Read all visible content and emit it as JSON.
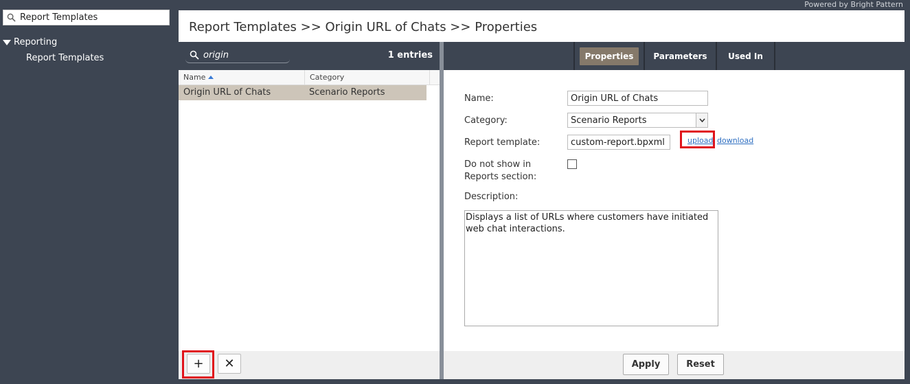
{
  "sidebar": {
    "search_value": "Report Templates",
    "tree": [
      {
        "label": "Reporting",
        "children": [
          {
            "label": "Report Templates"
          }
        ]
      }
    ]
  },
  "powered_by": "Powered by Bright Pattern",
  "breadcrumb": "Report Templates >> Origin URL of Chats >> Properties",
  "list": {
    "search_value": "origin",
    "entries_count": "1 entries",
    "columns": [
      "Name",
      "Category"
    ],
    "rows": [
      {
        "name": "Origin URL of Chats",
        "category": "Scenario Reports",
        "selected": true
      }
    ],
    "add_label": "+",
    "delete_label": "✕"
  },
  "tabs": [
    {
      "label": "Properties",
      "active": true
    },
    {
      "label": "Parameters",
      "active": false
    },
    {
      "label": "Used In",
      "active": false
    }
  ],
  "form": {
    "name_label": "Name:",
    "name_value": "Origin URL of Chats",
    "category_label": "Category:",
    "category_value": "Scenario Reports",
    "template_label": "Report template:",
    "template_value": "custom-report.bpxml",
    "upload_label": "upload",
    "download_label": "download",
    "hide_label_line1": "Do not show in",
    "hide_label_line2": "Reports section:",
    "hide_checked": false,
    "description_label": "Description:",
    "description_value": "Displays a list of URLs where customers have initiated web chat interactions."
  },
  "actions": {
    "apply_label": "Apply",
    "reset_label": "Reset"
  },
  "colors": {
    "background": "#3d4552",
    "selected_row": "#cdc5b9",
    "active_tab": "#85796a",
    "highlight": "#e0131b",
    "link": "#2f6fc1"
  }
}
